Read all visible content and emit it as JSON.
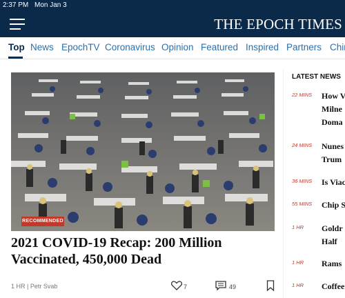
{
  "status_bar": {
    "time": "2:37 PM",
    "date": "Mon Jan 3"
  },
  "header": {
    "logo": "THE EPOCH TIMES"
  },
  "nav": {
    "items": [
      {
        "label": "Top",
        "active": true
      },
      {
        "label": "News"
      },
      {
        "label": "EpochTV"
      },
      {
        "label": "Coronavirus"
      },
      {
        "label": "Opinion"
      },
      {
        "label": "Featured"
      },
      {
        "label": "Inspired"
      },
      {
        "label": "Partners"
      },
      {
        "label": "Chin"
      }
    ]
  },
  "article": {
    "badge": "RECOMMENDED",
    "headline_line1": "2021 COVID-19 Recap: 200 Million",
    "headline_line2": "Vaccinated, 450,000 Dead",
    "byline": "1 HR | Petr Svab",
    "likes": "7",
    "comments": "49"
  },
  "latest_news": {
    "title": "LATEST NEWS",
    "items": [
      {
        "time": "22 MINS",
        "lines": [
          "How V",
          "Milne",
          "Doma"
        ]
      },
      {
        "time": "24 MINS",
        "lines": [
          "Nunes",
          "Trum"
        ]
      },
      {
        "time": "36 MINS",
        "lines": [
          "Is Viac"
        ]
      },
      {
        "time": "55 MINS",
        "lines": [
          "Chip S"
        ]
      },
      {
        "time": "1 HR",
        "lines": [
          "Goldr",
          "Half"
        ]
      },
      {
        "time": "1 HR",
        "lines": [
          "Rams"
        ]
      },
      {
        "time": "1 HR",
        "lines": [
          "Coffee"
        ]
      }
    ]
  },
  "colors": {
    "brand_navy": "#0b2a4a",
    "link_blue": "#2c6fa8",
    "badge_red": "#c0392b"
  }
}
